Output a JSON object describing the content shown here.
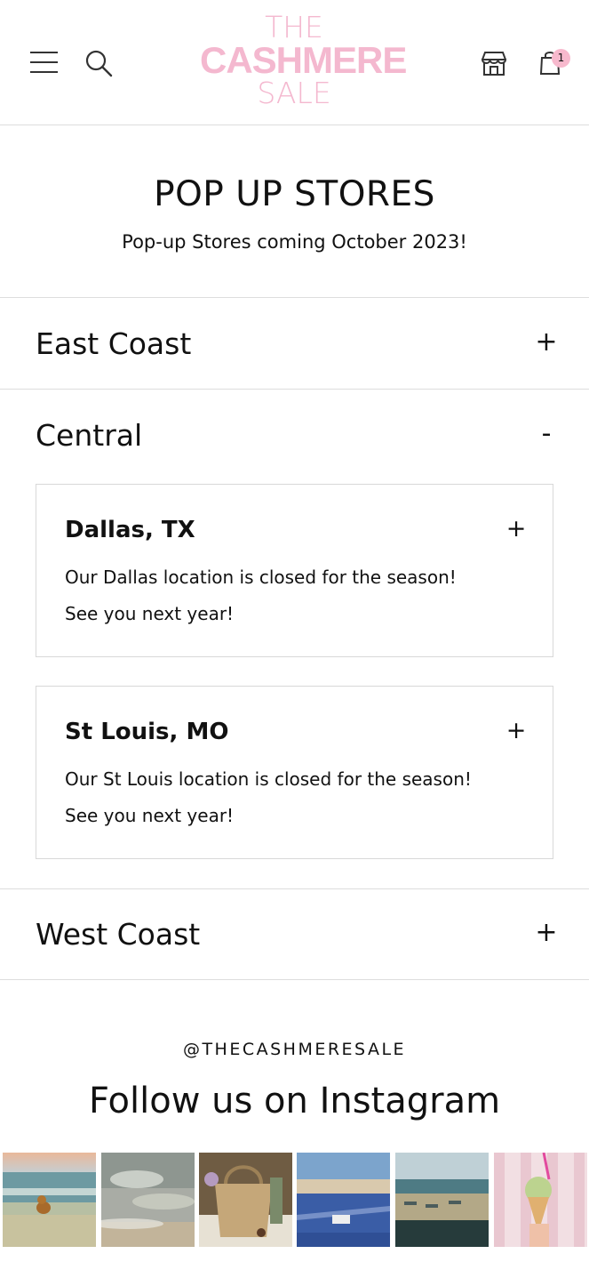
{
  "header": {
    "logo": {
      "line1": "THE",
      "line2": "CASHMERE",
      "line3": "SALE"
    },
    "cart_count": "1",
    "colors": {
      "logo_pink": "#f4b8cf",
      "badge_pink": "#f7b9cd"
    },
    "icons": [
      "hamburger-menu-icon",
      "search-icon",
      "store-icon",
      "cart-icon"
    ]
  },
  "hero": {
    "title": "POP UP STORES",
    "subtitle": "Pop-up Stores coming October 2023!"
  },
  "regions": [
    {
      "label": "East Coast",
      "sign": "+"
    },
    {
      "label": "Central",
      "sign": "-"
    },
    {
      "label": "West Coast",
      "sign": "+"
    }
  ],
  "stores": [
    {
      "name": "Dallas, TX",
      "sign": "+",
      "line1": "Our Dallas location is closed for the season!",
      "line2": "See you next year!"
    },
    {
      "name": "St Louis, MO",
      "sign": "+",
      "line1": "Our St Louis location is closed for the season!",
      "line2": "See you next year!"
    }
  ],
  "instagram": {
    "handle": "@THECASHMERESALE",
    "heading": "Follow us on Instagram",
    "posts": [
      "dog-at-beach-photo",
      "ocean-water-photo",
      "straw-bag-picnic-photo",
      "beach-towel-photo",
      "beach-sunbeds-photo",
      "ice-cream-cone-photo"
    ]
  }
}
